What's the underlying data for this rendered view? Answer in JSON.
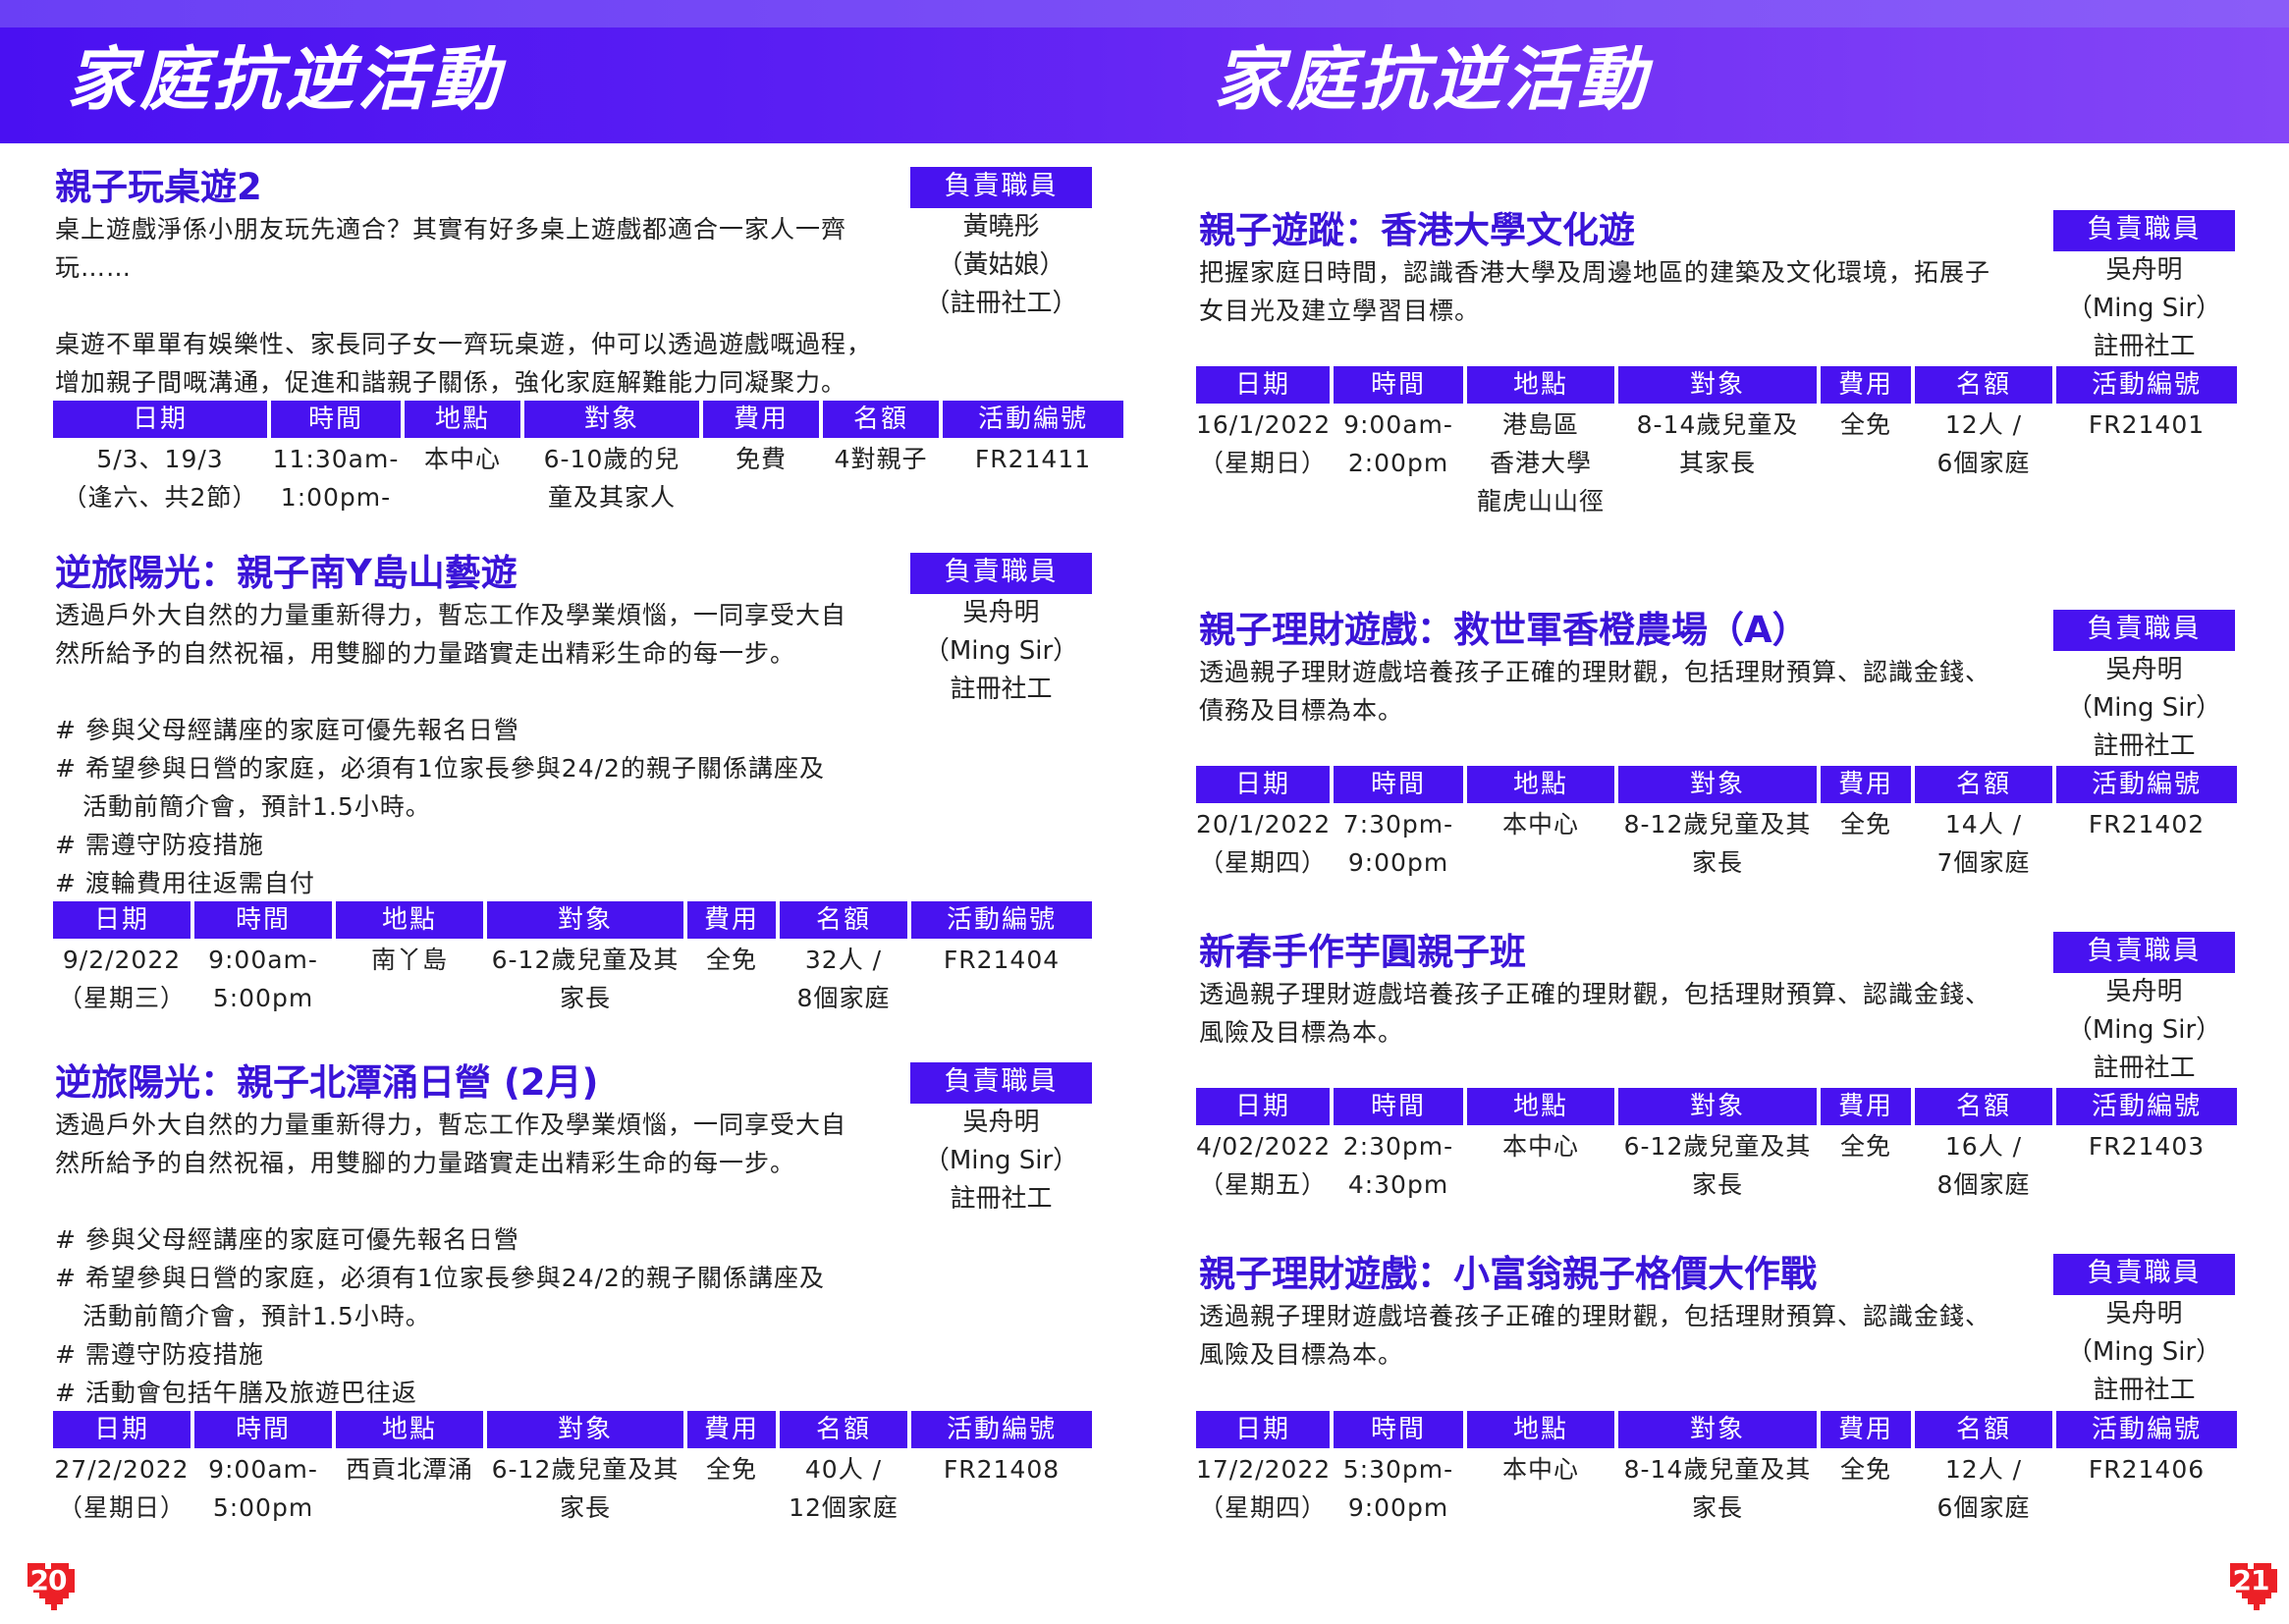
{
  "header": {
    "title_left": "家庭抗逆活動",
    "title_right": "家庭抗逆活動"
  },
  "table_headers": {
    "date": "日期",
    "time": "時間",
    "place": "地點",
    "target": "對象",
    "fee": "費用",
    "quota": "名額",
    "code": "活動編號"
  },
  "staff_label": "負責職員",
  "activities": [
    {
      "title": "親子玩桌遊2",
      "desc": [
        "桌上遊戲淨係小朋友玩先適合？其實有好多桌上遊戲都適合一家人一齊",
        "玩……",
        "",
        "桌遊不單單有娛樂性、家長同子女一齊玩桌遊，仲可以透過遊戲嘅過程，",
        "增加親子間嘅溝通，促進和諧親子關係，強化家庭解難能力同凝聚力。"
      ],
      "staff": [
        "黃曉彤",
        "（黃姑娘）",
        "（註冊社工）"
      ],
      "row": {
        "date": [
          "5/3、19/3",
          "（逢六、共2節）"
        ],
        "time": [
          "11:30am-",
          "1:00pm-"
        ],
        "place": [
          "本中心"
        ],
        "target": [
          "6-10歲的兒",
          "童及其家人"
        ],
        "fee": [
          "免費"
        ],
        "quota": [
          "4對親子"
        ],
        "code": [
          "FR21411"
        ]
      }
    },
    {
      "title": "逆旅陽光：親子南Y島山藝遊",
      "desc": [
        "透過戶外大自然的力量重新得力，暫忘工作及學業煩惱，一同享受大自",
        "然所給予的自然祝福，用雙腳的力量踏實走出精彩生命的每一步。",
        "",
        "# 參與父母經講座的家庭可優先報名日營",
        "# 希望參與日營的家庭，必須有1位家長參與24/2的親子關係講座及",
        "   活動前簡介會，預計1.5小時。",
        "# 需遵守防疫措施",
        "# 渡輪費用往返需自付"
      ],
      "staff": [
        "吳舟明",
        "（Ming Sir）",
        "註冊社工"
      ],
      "row": {
        "date": [
          "9/2/2022",
          "（星期三）"
        ],
        "time": [
          "9:00am-",
          "5:00pm"
        ],
        "place": [
          "南丫島"
        ],
        "target": [
          "6-12歲兒童及其",
          "家長"
        ],
        "fee": [
          "全免"
        ],
        "quota": [
          "32人 /",
          "8個家庭"
        ],
        "code": [
          "FR21404"
        ]
      }
    },
    {
      "title": "逆旅陽光：親子北潭涌日營 (2月)",
      "desc": [
        "透過戶外大自然的力量重新得力，暫忘工作及學業煩惱，一同享受大自",
        "然所給予的自然祝福，用雙腳的力量踏實走出精彩生命的每一步。",
        "",
        "# 參與父母經講座的家庭可優先報名日營",
        "# 希望參與日營的家庭，必須有1位家長參與24/2的親子關係講座及",
        "   活動前簡介會，預計1.5小時。",
        "# 需遵守防疫措施",
        "# 活動會包括午膳及旅遊巴往返"
      ],
      "staff": [
        "吳舟明",
        "（Ming Sir）",
        "註冊社工"
      ],
      "row": {
        "date": [
          "27/2/2022",
          "（星期日）"
        ],
        "time": [
          "9:00am-",
          "5:00pm"
        ],
        "place": [
          "西貢北潭涌"
        ],
        "target": [
          "6-12歲兒童及其",
          "家長"
        ],
        "fee": [
          "全免"
        ],
        "quota": [
          "40人 /",
          "12個家庭"
        ],
        "code": [
          "FR21408"
        ]
      }
    },
    {
      "title": "親子遊蹤：香港大學文化遊",
      "desc": [
        "把握家庭日時間，認識香港大學及周邊地區的建築及文化環境，拓展子",
        "女目光及建立學習目標。"
      ],
      "staff": [
        "吳舟明",
        "（Ming Sir）",
        "註冊社工"
      ],
      "row": {
        "date": [
          "16/1/2022",
          "（星期日）"
        ],
        "time": [
          "9:00am-",
          "2:00pm"
        ],
        "place": [
          "港島區",
          "香港大學",
          "龍虎山山徑"
        ],
        "target": [
          "8-14歲兒童及",
          "其家長"
        ],
        "fee": [
          "全免"
        ],
        "quota": [
          "12人 /",
          "6個家庭"
        ],
        "code": [
          "FR21401"
        ]
      }
    },
    {
      "title": "親子理財遊戲：救世軍香橙農場（A）",
      "desc": [
        "透過親子理財遊戲培養孩子正確的理財觀，包括理財預算、認識金錢、",
        "債務及目標為本。"
      ],
      "staff": [
        "吳舟明",
        "（Ming Sir）",
        "註冊社工"
      ],
      "row": {
        "date": [
          "20/1/2022",
          "（星期四）"
        ],
        "time": [
          "7:30pm-",
          "9:00pm"
        ],
        "place": [
          "本中心"
        ],
        "target": [
          "8-12歲兒童及其",
          "家長"
        ],
        "fee": [
          "全免"
        ],
        "quota": [
          "14人 /",
          "7個家庭"
        ],
        "code": [
          "FR21402"
        ]
      }
    },
    {
      "title": "新春手作芋圓親子班",
      "desc": [
        "透過親子理財遊戲培養孩子正確的理財觀，包括理財預算、認識金錢、",
        "風險及目標為本。"
      ],
      "staff": [
        "吳舟明",
        "（Ming Sir）",
        "註冊社工"
      ],
      "row": {
        "date": [
          "4/02/2022",
          "（星期五）"
        ],
        "time": [
          "2:30pm-",
          "4:30pm"
        ],
        "place": [
          "本中心"
        ],
        "target": [
          "6-12歲兒童及其",
          "家長"
        ],
        "fee": [
          "全免"
        ],
        "quota": [
          "16人 /",
          "8個家庭"
        ],
        "code": [
          "FR21403"
        ]
      }
    },
    {
      "title": "親子理財遊戲：小富翁親子格價大作戰",
      "desc": [
        "透過親子理財遊戲培養孩子正確的理財觀，包括理財預算、認識金錢、",
        "風險及目標為本。"
      ],
      "staff": [
        "吳舟明",
        "（Ming Sir）",
        "註冊社工"
      ],
      "row": {
        "date": [
          "17/2/2022",
          "（星期四）"
        ],
        "time": [
          "5:30pm-",
          "9:00pm"
        ],
        "place": [
          "本中心"
        ],
        "target": [
          "8-14歲兒童及其",
          "家長"
        ],
        "fee": [
          "全免"
        ],
        "quota": [
          "12人 /",
          "6個家庭"
        ],
        "code": [
          "FR21406"
        ]
      }
    }
  ],
  "page_numbers": {
    "left": "20",
    "right": "21"
  },
  "colors": {
    "brand_purple": "#4812f0",
    "title_purple": "#3a14d8",
    "page_badge_red": "#ec2026"
  }
}
